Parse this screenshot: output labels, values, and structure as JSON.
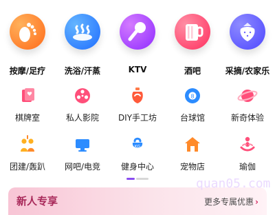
{
  "primary_categories": [
    {
      "label": "按摩/足疗",
      "icon": "foot-icon",
      "color": "#ff7a2a"
    },
    {
      "label": "洗浴/汗蒸",
      "icon": "spa-steam-icon",
      "color": "#2c8cff"
    },
    {
      "label": "KTV",
      "icon": "microphone-icon",
      "color": "#b23cff"
    },
    {
      "label": "酒吧",
      "icon": "beer-icon",
      "color": "#ff3f6a"
    },
    {
      "label": "采摘/农家乐",
      "icon": "strawberry-icon",
      "color": "#6b63ff"
    }
  ],
  "secondary_categories": [
    {
      "label": "棋牌室",
      "icon": "cards-icon",
      "color": "#ff4f7a"
    },
    {
      "label": "私人影院",
      "icon": "film-reel-icon",
      "color": "#ff4f7a"
    },
    {
      "label": "DIY手工坊",
      "icon": "craft-pot-icon",
      "color": "#ff6a4a"
    },
    {
      "label": "台球馆",
      "icon": "billiard-ball-icon",
      "color": "#2c8cff"
    },
    {
      "label": "新奇体验",
      "icon": "planet-icon",
      "color": "#ff4f7a"
    },
    {
      "label": "团建/轰趴",
      "icon": "team-icon",
      "color": "#ffb020"
    },
    {
      "label": "网吧/电竞",
      "icon": "monitor-icon",
      "color": "#2c8cff"
    },
    {
      "label": "健身中心",
      "icon": "kettlebell-icon",
      "color": "#2c8cff"
    },
    {
      "label": "宠物店",
      "icon": "pet-house-icon",
      "color": "#ff8a2a"
    },
    {
      "label": "瑜伽",
      "icon": "yoga-icon",
      "color": "#ff4f7a"
    }
  ],
  "pager": {
    "current": 1,
    "total": 2
  },
  "banner": {
    "title": "新人专享",
    "more_label": "更多专属优惠",
    "more_icon": "chevron-right-icon"
  },
  "watermark": {
    "text": "quan05.com"
  }
}
